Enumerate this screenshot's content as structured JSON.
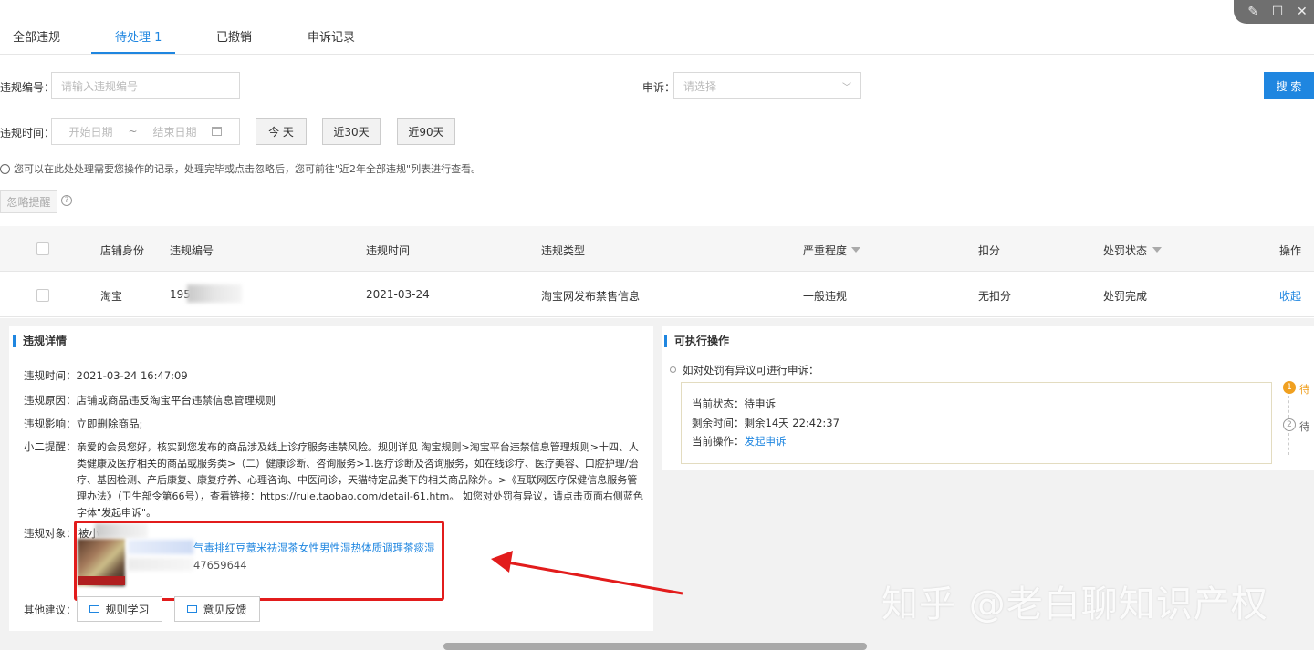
{
  "tabs": [
    {
      "label": "全部违规"
    },
    {
      "label": "待处理",
      "count": "1"
    },
    {
      "label": "已撤销"
    },
    {
      "label": "申诉记录"
    }
  ],
  "form": {
    "id_label": "违规编号：",
    "id_placeholder": "请输入违规编号",
    "appeal_label": "申诉：",
    "appeal_placeholder": "请选择",
    "search_label": "搜 索",
    "time_label": "违规时间：",
    "start_placeholder": "开始日期",
    "tilde": "~",
    "end_placeholder": "结束日期",
    "today": "今 天",
    "d30": "近30天",
    "d90": "近90天"
  },
  "hint": "您可以在此处处理需要您操作的记录，处理完毕或点击忽略后，您可前往\"近2年全部违规\"列表进行查看。",
  "ignore_button": "忽略提醒",
  "table": {
    "headers": [
      "店铺身份",
      "违规编号",
      "违规时间",
      "违规类型",
      "严重程度",
      "扣分",
      "处罚状态",
      "操作"
    ],
    "row": {
      "shop": "淘宝",
      "id_prefix": "195",
      "time": "2021-03-24",
      "type": "淘宝网发布禁售信息",
      "severity": "一般违规",
      "points": "无扣分",
      "status": "处罚完成",
      "action": "收起"
    }
  },
  "detail": {
    "title": "违规详情",
    "time_k": "违规时间：",
    "time_v": "2021-03-24 16:47:09",
    "reason_k": "违规原因：",
    "reason_v": "店铺或商品违反淘宝平台违禁信息管理规则",
    "impact_k": "违规影响：",
    "impact_v": "立即删除商品;",
    "notice_k": "小二提醒：",
    "notice_v": "亲爱的会员您好，核实到您发布的商品涉及线上诊疗服务违禁风险。规则详见 淘宝规则>淘宝平台违禁信息管理规则>十四、人类健康及医疗相关的商品或服务类>（二）健康诊断、咨询服务>1.医疗诊断及咨询服务，如在线诊疗、医疗美容、口腔护理/治疗、基因检测、产后康复、康复疗养、心理咨询、中医问诊，天猫特定品类下的相关商品除外。>《互联网医疗保健信息服务管理办法》（卫生部令第66号），查看链接：https://rule.taobao.com/detail-61.htm。 如您对处罚有异议，请点击页面右侧蓝色字体\"发起申诉\"。",
    "object_k": "违规对象：",
    "object_prefix": "被小",
    "product_title": "气毒排红豆薏米祛湿茶女性男性湿热体质调理茶痰湿",
    "product_id": "47659644",
    "other_k": "其他建议：",
    "rules_btn": "规则学习",
    "feedback_btn": "意见反馈"
  },
  "actions": {
    "title": "可执行操作",
    "note": "如对处罚有异议可进行申诉：",
    "status_k": "当前状态：",
    "status_v": "待申诉",
    "remain_k": "剩余时间：",
    "remain_v": "剩余14天 22:42:37",
    "op_k": "当前操作：",
    "op_v": "发起申诉",
    "step1": "待",
    "step2": "待"
  },
  "watermark": "知乎 @老白聊知识产权",
  "colors": {
    "accent": "#1f86e0",
    "highlight": "#e21c1c"
  }
}
